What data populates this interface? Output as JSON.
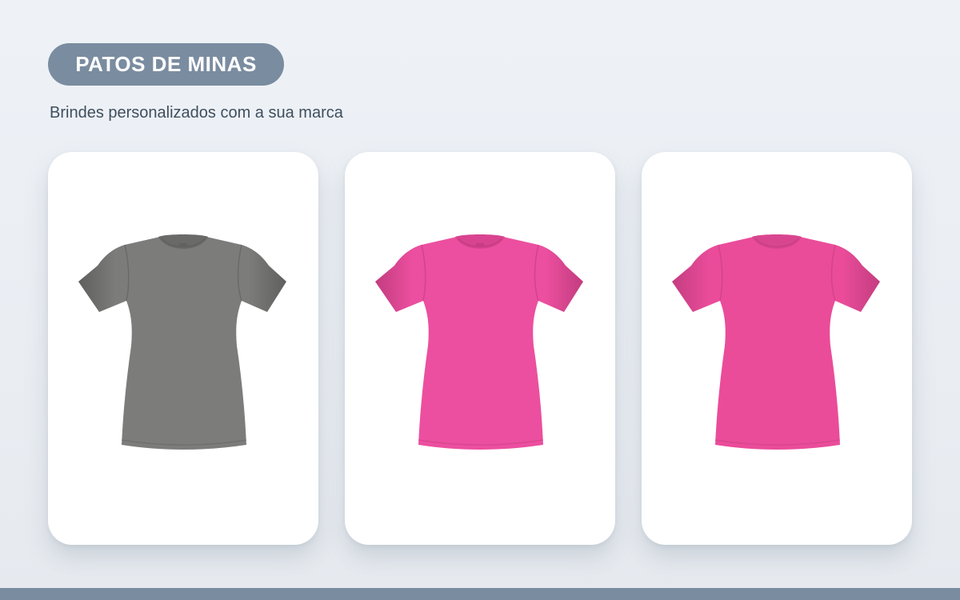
{
  "header": {
    "city": "PATOS DE MINAS",
    "tagline": "Brindes personalizados com a sua marca"
  },
  "products": [
    {
      "icon": "t-shirt-icon",
      "color": "#7c7c7b",
      "shade": "#5f5f5e",
      "collar": "#6a6a69",
      "variant": "tagged"
    },
    {
      "icon": "t-shirt-icon",
      "color": "#ec4f9f",
      "shade": "#c23c7f",
      "collar": "#d8448f",
      "variant": "tagged"
    },
    {
      "icon": "t-shirt-icon",
      "color": "#ea4c9a",
      "shade": "#c43d80",
      "collar": "#d94690",
      "variant": "plain"
    }
  ],
  "theme": {
    "accent": "#7a8ca0",
    "background": "#eef2f7",
    "card": "#ffffff",
    "text": "#3f4e5d"
  }
}
